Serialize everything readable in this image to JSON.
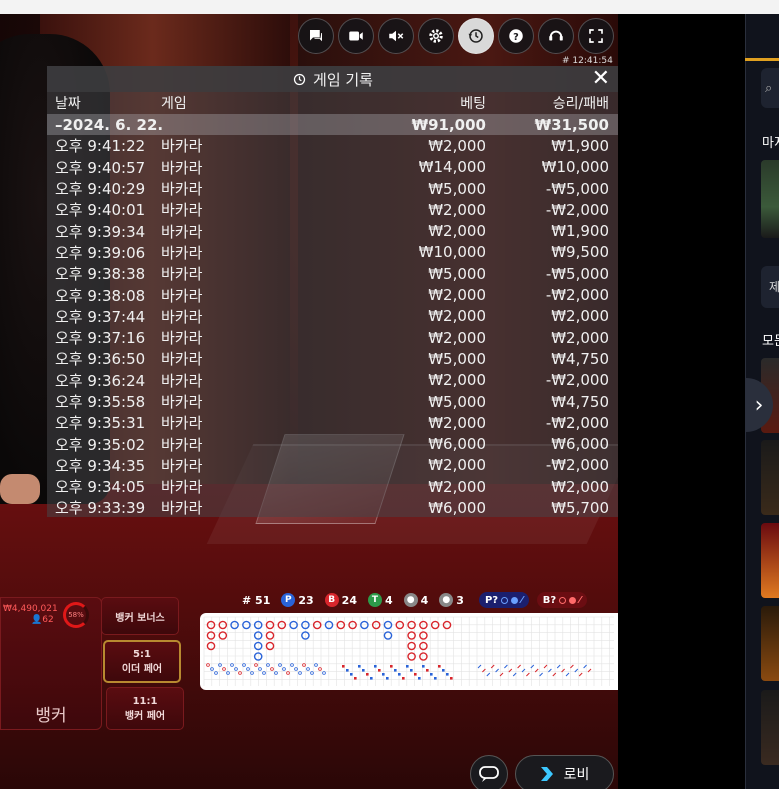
{
  "controls": {
    "icons": [
      "chat-icon",
      "video-icon",
      "mute-icon",
      "settings-icon",
      "history-icon",
      "help-icon",
      "support-icon",
      "fullscreen-icon"
    ],
    "round_id": "# 12:41:54"
  },
  "history": {
    "title": "게임 기록",
    "columns": {
      "date": "날짜",
      "game": "게임",
      "bet": "베팅",
      "winloss": "승리/패배"
    },
    "summary": {
      "date": "–2024. 6. 22.",
      "game": "",
      "bet": "₩91,000",
      "winloss": "₩31,500"
    },
    "rows": [
      {
        "time": "오후 9:41:22",
        "game": "바카라",
        "bet": "₩2,000",
        "winloss": "₩1,900"
      },
      {
        "time": "오후 9:40:57",
        "game": "바카라",
        "bet": "₩14,000",
        "winloss": "₩10,000"
      },
      {
        "time": "오후 9:40:29",
        "game": "바카라",
        "bet": "₩5,000",
        "winloss": "-₩5,000"
      },
      {
        "time": "오후 9:40:01",
        "game": "바카라",
        "bet": "₩2,000",
        "winloss": "-₩2,000"
      },
      {
        "time": "오후 9:39:34",
        "game": "바카라",
        "bet": "₩2,000",
        "winloss": "₩1,900"
      },
      {
        "time": "오후 9:39:06",
        "game": "바카라",
        "bet": "₩10,000",
        "winloss": "₩9,500"
      },
      {
        "time": "오후 9:38:38",
        "game": "바카라",
        "bet": "₩5,000",
        "winloss": "-₩5,000"
      },
      {
        "time": "오후 9:38:08",
        "game": "바카라",
        "bet": "₩2,000",
        "winloss": "-₩2,000"
      },
      {
        "time": "오후 9:37:44",
        "game": "바카라",
        "bet": "₩2,000",
        "winloss": "₩2,000"
      },
      {
        "time": "오후 9:37:16",
        "game": "바카라",
        "bet": "₩2,000",
        "winloss": "₩2,000"
      },
      {
        "time": "오후 9:36:50",
        "game": "바카라",
        "bet": "₩5,000",
        "winloss": "₩4,750"
      },
      {
        "time": "오후 9:36:24",
        "game": "바카라",
        "bet": "₩2,000",
        "winloss": "-₩2,000"
      },
      {
        "time": "오후 9:35:58",
        "game": "바카라",
        "bet": "₩5,000",
        "winloss": "₩4,750"
      },
      {
        "time": "오후 9:35:31",
        "game": "바카라",
        "bet": "₩2,000",
        "winloss": "-₩2,000"
      },
      {
        "time": "오후 9:35:02",
        "game": "바카라",
        "bet": "₩6,000",
        "winloss": "₩6,000"
      },
      {
        "time": "오후 9:34:35",
        "game": "바카라",
        "bet": "₩2,000",
        "winloss": "-₩2,000"
      },
      {
        "time": "오후 9:34:05",
        "game": "바카라",
        "bet": "₩2,000",
        "winloss": "₩2,000"
      },
      {
        "time": "오후 9:33:39",
        "game": "바카라",
        "bet": "₩6,000",
        "winloss": "₩5,700"
      }
    ]
  },
  "stats": {
    "rounds": "# 51",
    "player_letter": "P",
    "player": "23",
    "banker_letter": "B",
    "banker": "24",
    "tie_letter": "T",
    "tie": "4",
    "player_pair": "4",
    "banker_pair": "3",
    "player_predict": "P?",
    "banker_predict": "B?"
  },
  "bets": {
    "banker_total": "₩4,490,021",
    "banker_players": "62",
    "banker_percent": "58%",
    "banker_label": "뱅커",
    "banker_bonus": "뱅커 보너스",
    "either_pair_odds": "5:1",
    "either_pair": "이더 페어",
    "banker_pair_odds": "11:1",
    "banker_pair": "뱅커 페어"
  },
  "lobby_label": "로비",
  "sidebar": {
    "text1": "마지",
    "text2": "모든",
    "button": "제"
  },
  "colors": {
    "banker": "#d8262c",
    "player": "#2a63d8",
    "tie": "#2d9a4a",
    "accent": "#e0a020"
  }
}
